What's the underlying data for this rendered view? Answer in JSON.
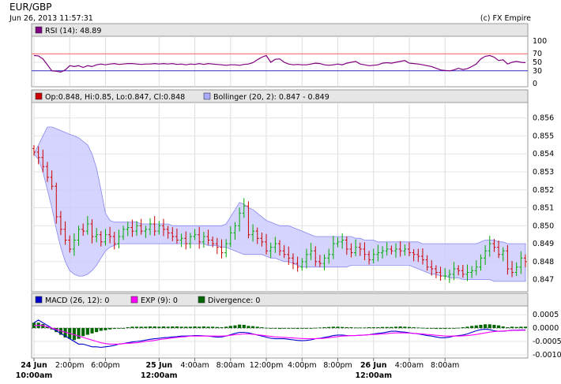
{
  "header": {
    "symbol": "EUR/GBP",
    "timestamp": "Jun 26, 2013 11:57:31",
    "credit": "(c) FX Empire"
  },
  "chart_data": [
    {
      "id": "rsi",
      "type": "line",
      "legend": "RSI (14): 48.89",
      "colors": {
        "line": "#800080",
        "upper": "#ff6666",
        "lower": "#3333cc",
        "swatch": "#800080"
      },
      "ylim": [
        0,
        100
      ],
      "ticks": [
        "100",
        "70",
        "50",
        "30",
        "0"
      ],
      "tick_values": [
        100,
        70,
        50,
        30,
        0
      ],
      "levels": [
        70,
        30
      ],
      "values": [
        66,
        65,
        58,
        44,
        30,
        29,
        27,
        32,
        42,
        40,
        42,
        38,
        42,
        40,
        44,
        46,
        44,
        46,
        47,
        45,
        46,
        47,
        47,
        46,
        45,
        46,
        46,
        47,
        46,
        47,
        46,
        47,
        45,
        46,
        44,
        46,
        45,
        47,
        45,
        47,
        46,
        45,
        44,
        43,
        44,
        44,
        43,
        45,
        46,
        49,
        56,
        62,
        66,
        50,
        57,
        58,
        50,
        46,
        44,
        45,
        44,
        44,
        46,
        48,
        47,
        44,
        43,
        44,
        46,
        44,
        48,
        50,
        52,
        46,
        44,
        42,
        43,
        44,
        48,
        49,
        48,
        50,
        52,
        54,
        48,
        47,
        46,
        44,
        42,
        40,
        36,
        32,
        31,
        30,
        32,
        36,
        33,
        35,
        40,
        46,
        58,
        64,
        66,
        62,
        54,
        56,
        46,
        50,
        52,
        50,
        49
      ]
    },
    {
      "id": "price",
      "type": "candlestick",
      "legend_ohlc": "Op:0.848, Hi:0.85, Lo:0.847, Cl:0.848",
      "legend_bollinger": "Bollinger (20, 2): 0.847 - 0.849",
      "colors": {
        "up": "#00aa00",
        "down": "#cc0000",
        "band_fill": "#ccccff",
        "band_edge": "#8888ee",
        "swatch_ohlc": "#cc0000",
        "swatch_boll": "#aaaaff"
      },
      "ylim": [
        0.8465,
        0.8566
      ],
      "ticks": [
        "0.856",
        "0.855",
        "0.854",
        "0.853",
        "0.852",
        "0.851",
        "0.850",
        "0.849",
        "0.848",
        "0.847"
      ],
      "tick_values": [
        0.856,
        0.855,
        0.854,
        0.853,
        0.852,
        0.851,
        0.85,
        0.849,
        0.848,
        0.847
      ],
      "close": [
        0.8541,
        0.8538,
        0.8533,
        0.8527,
        0.8522,
        0.8505,
        0.8498,
        0.8492,
        0.8487,
        0.8492,
        0.8498,
        0.8497,
        0.8501,
        0.8494,
        0.8495,
        0.8491,
        0.8495,
        0.8494,
        0.849,
        0.8494,
        0.8498,
        0.8499,
        0.8497,
        0.85,
        0.8497,
        0.8498,
        0.8501,
        0.8497,
        0.85,
        0.8498,
        0.8496,
        0.8494,
        0.8492,
        0.8493,
        0.849,
        0.8494,
        0.8495,
        0.8491,
        0.8494,
        0.8492,
        0.849,
        0.8488,
        0.8485,
        0.849,
        0.8496,
        0.85,
        0.8507,
        0.8511,
        0.8495,
        0.8497,
        0.8493,
        0.8491,
        0.8486,
        0.8488,
        0.849,
        0.8486,
        0.8484,
        0.8482,
        0.8479,
        0.8477,
        0.848,
        0.8484,
        0.8486,
        0.848,
        0.8479,
        0.8482,
        0.8484,
        0.849,
        0.8491,
        0.8492,
        0.8487,
        0.8485,
        0.8488,
        0.8487,
        0.8484,
        0.8481,
        0.8484,
        0.8485,
        0.8486,
        0.8487,
        0.8486,
        0.8487,
        0.8486,
        0.8487,
        0.8485,
        0.8484,
        0.8483,
        0.8481,
        0.8477,
        0.8476,
        0.8474,
        0.8472,
        0.8472,
        0.8473,
        0.8476,
        0.8475,
        0.8473,
        0.8474,
        0.8475,
        0.8477,
        0.8482,
        0.8486,
        0.849,
        0.8488,
        0.8484,
        0.8486,
        0.8476,
        0.8474,
        0.8477,
        0.8482,
        0.848
      ],
      "bollinger_upper": [
        0.854,
        0.8545,
        0.855,
        0.8555,
        0.8555,
        0.8554,
        0.8553,
        0.8552,
        0.8551,
        0.855,
        0.8549,
        0.8547,
        0.8545,
        0.854,
        0.8532,
        0.852,
        0.8507,
        0.8503,
        0.8502,
        0.8502,
        0.8502,
        0.8502,
        0.8502,
        0.8502,
        0.8501,
        0.8501,
        0.8501,
        0.8501,
        0.8501,
        0.8501,
        0.8501,
        0.85,
        0.85,
        0.85,
        0.85,
        0.85,
        0.85,
        0.85,
        0.85,
        0.85,
        0.85,
        0.85,
        0.85,
        0.8501,
        0.8505,
        0.8509,
        0.8513,
        0.8512,
        0.851,
        0.8509,
        0.8507,
        0.8505,
        0.8503,
        0.8502,
        0.8501,
        0.85,
        0.85,
        0.85,
        0.8499,
        0.8498,
        0.8497,
        0.8496,
        0.8495,
        0.8494,
        0.8494,
        0.8494,
        0.8494,
        0.8494,
        0.8494,
        0.8494,
        0.8494,
        0.8494,
        0.8493,
        0.8493,
        0.8492,
        0.8492,
        0.8492,
        0.8491,
        0.8491,
        0.8491,
        0.8491,
        0.8491,
        0.8491,
        0.8491,
        0.8491,
        0.8491,
        0.8491,
        0.849,
        0.849,
        0.849,
        0.849,
        0.849,
        0.849,
        0.849,
        0.849,
        0.849,
        0.849,
        0.849,
        0.849,
        0.849,
        0.8491,
        0.8492,
        0.8492,
        0.8492,
        0.8491,
        0.8491,
        0.849,
        0.849,
        0.849,
        0.849,
        0.849
      ],
      "bollinger_lower": [
        0.854,
        0.8537,
        0.853,
        0.852,
        0.851,
        0.8498,
        0.8488,
        0.848,
        0.8475,
        0.8473,
        0.8472,
        0.8472,
        0.8473,
        0.8475,
        0.8478,
        0.8482,
        0.8486,
        0.8488,
        0.8489,
        0.849,
        0.849,
        0.849,
        0.849,
        0.849,
        0.849,
        0.849,
        0.849,
        0.849,
        0.849,
        0.849,
        0.849,
        0.849,
        0.849,
        0.849,
        0.849,
        0.849,
        0.849,
        0.849,
        0.849,
        0.8489,
        0.8489,
        0.8489,
        0.8488,
        0.8488,
        0.8487,
        0.8486,
        0.8485,
        0.8484,
        0.8484,
        0.8484,
        0.8484,
        0.8484,
        0.8483,
        0.8482,
        0.8482,
        0.8481,
        0.848,
        0.848,
        0.8479,
        0.8478,
        0.8477,
        0.8477,
        0.8477,
        0.8477,
        0.8477,
        0.8477,
        0.8477,
        0.8477,
        0.8477,
        0.8477,
        0.8477,
        0.8478,
        0.8478,
        0.8478,
        0.8478,
        0.8478,
        0.8478,
        0.8478,
        0.8478,
        0.8478,
        0.8478,
        0.8478,
        0.8478,
        0.8478,
        0.8478,
        0.8477,
        0.8476,
        0.8475,
        0.8474,
        0.8473,
        0.8473,
        0.8472,
        0.8472,
        0.8471,
        0.8471,
        0.8471,
        0.847,
        0.847,
        0.847,
        0.847,
        0.847,
        0.847,
        0.847,
        0.8469,
        0.8469,
        0.8469,
        0.8469,
        0.8469,
        0.8469,
        0.8469,
        0.8469
      ]
    },
    {
      "id": "macd",
      "type": "bar+line",
      "legend_macd": "MACD (26, 12): 0",
      "legend_exp": "EXP (9): 0",
      "legend_div": "Divergence: 0",
      "colors": {
        "macd": "#0000cc",
        "exp": "#ff00ff",
        "div": "#006600"
      },
      "ylim": [
        -0.001,
        0.00065
      ],
      "ticks": [
        "0.0005",
        "0.0000",
        "-0.0005",
        "-0.0010"
      ],
      "tick_values": [
        0.0005,
        0,
        -0.0005,
        -0.001
      ],
      "divergence": [
        0.0002,
        0.0002,
        0.00015,
        5e-05,
        -5e-05,
        -0.00015,
        -0.00025,
        -0.00035,
        -0.0004,
        -0.00045,
        -0.0004,
        -0.0003,
        -0.00025,
        -0.0002,
        -0.00015,
        -0.0001,
        -8e-05,
        -5e-05,
        -3e-05,
        -2e-05,
        0,
        3e-05,
        5e-05,
        5e-05,
        5e-05,
        5e-05,
        6e-05,
        6e-05,
        5e-05,
        6e-05,
        5e-05,
        6e-05,
        6e-05,
        5e-05,
        5e-05,
        5e-05,
        6e-05,
        5e-05,
        6e-05,
        5e-05,
        5e-05,
        4e-05,
        3e-05,
        5e-05,
        8e-05,
        0.0001,
        0.00013,
        0.00012,
        8e-05,
        7e-05,
        5e-05,
        3e-05,
        1e-05,
        -1e-05,
        -2e-05,
        -3e-05,
        -2e-05,
        -1e-05,
        -2e-05,
        -3e-05,
        -2e-05,
        -1e-05,
        0,
        1e-05,
        2e-05,
        3e-05,
        4e-05,
        5e-05,
        5e-05,
        4e-05,
        3e-05,
        3e-05,
        2e-05,
        2e-05,
        2e-05,
        3e-05,
        3e-05,
        3e-05,
        4e-05,
        4e-05,
        4e-05,
        5e-05,
        6e-05,
        5e-05,
        4e-05,
        3e-05,
        2e-05,
        1e-05,
        -1e-05,
        -2e-05,
        -3e-05,
        -3e-05,
        -3e-05,
        -2e-05,
        -1e-05,
        1e-05,
        3e-05,
        5e-05,
        8e-05,
        0.0001,
        0.00012,
        0.00014,
        0.00014,
        0.00012,
        0.0001,
        6e-05,
        3e-05,
        5e-05,
        4e-05,
        5e-05,
        5e-05
      ],
      "macd": [
        0.0002,
        0.0003,
        0.0002,
        0.0001,
        0,
        -0.0001,
        -0.0002,
        -0.0003,
        -0.0004,
        -0.0005,
        -0.0006,
        -0.0006,
        -0.00065,
        -0.0007,
        -0.0007,
        -0.00072,
        -0.0007,
        -0.00068,
        -0.00065,
        -0.0006,
        -0.00058,
        -0.00055,
        -0.00052,
        -0.0005,
        -0.00048,
        -0.00045,
        -0.00042,
        -0.0004,
        -0.00038,
        -0.00036,
        -0.00035,
        -0.00033,
        -0.00032,
        -0.0003,
        -0.0003,
        -0.00029,
        -0.00028,
        -0.00028,
        -0.00029,
        -0.0003,
        -0.00032,
        -0.00034,
        -0.00033,
        -0.0003,
        -0.00025,
        -0.0002,
        -0.00016,
        -0.00016,
        -0.00018,
        -0.00022,
        -0.00026,
        -0.0003,
        -0.00034,
        -0.00038,
        -0.0004,
        -0.0004,
        -0.0004,
        -0.00042,
        -0.00044,
        -0.00046,
        -0.00047,
        -0.00046,
        -0.00044,
        -0.0004,
        -0.00038,
        -0.00035,
        -0.00032,
        -0.00028,
        -0.00026,
        -0.00026,
        -0.00028,
        -0.00028,
        -0.00028,
        -0.00027,
        -0.00026,
        -0.00025,
        -0.00022,
        -0.0002,
        -0.00018,
        -0.00015,
        -0.00012,
        -0.00012,
        -0.00014,
        -0.00015,
        -0.00018,
        -0.0002,
        -0.00022,
        -0.00025,
        -0.00028,
        -0.0003,
        -0.00033,
        -0.00036,
        -0.00036,
        -0.00034,
        -0.0003,
        -0.00028,
        -0.00026,
        -0.00022,
        -0.00016,
        -0.0001,
        -6e-05,
        -4e-05,
        -6e-05,
        -0.0001,
        -0.00012,
        -0.00012,
        -0.0001,
        -8e-05,
        -8e-05,
        -7e-05,
        -7e-05
      ],
      "exp": [
        0.0001,
        0.0001,
        0.0001,
        5e-05,
        0,
        -5e-05,
        -0.0001,
        -0.00015,
        -0.0002,
        -0.00025,
        -0.0003,
        -0.00035,
        -0.0004,
        -0.00045,
        -0.0005,
        -0.00055,
        -0.00058,
        -0.0006,
        -0.0006,
        -0.0006,
        -0.00058,
        -0.00057,
        -0.00056,
        -0.00055,
        -0.00053,
        -0.0005,
        -0.00048,
        -0.00046,
        -0.00043,
        -0.00041,
        -0.00039,
        -0.00037,
        -0.00035,
        -0.00033,
        -0.00032,
        -0.0003,
        -0.0003,
        -0.0003,
        -0.0003,
        -0.0003,
        -0.0003,
        -0.0003,
        -0.0003,
        -0.00029,
        -0.00027,
        -0.00025,
        -0.00023,
        -0.00022,
        -0.00022,
        -0.00023,
        -0.00025,
        -0.00027,
        -0.00029,
        -0.00031,
        -0.00033,
        -0.00034,
        -0.00035,
        -0.00036,
        -0.00037,
        -0.00038,
        -0.00039,
        -0.0004,
        -0.0004,
        -0.0004,
        -0.00039,
        -0.00038,
        -0.00036,
        -0.00034,
        -0.00032,
        -0.0003,
        -0.00029,
        -0.00028,
        -0.00028,
        -0.00027,
        -0.00026,
        -0.00025,
        -0.00024,
        -0.00023,
        -0.00022,
        -0.00021,
        -0.00019,
        -0.00018,
        -0.00018,
        -0.00018,
        -0.00019,
        -0.0002,
        -0.00021,
        -0.00022,
        -0.00024,
        -0.00025,
        -0.00027,
        -0.00028,
        -0.0003,
        -0.0003,
        -0.0003,
        -0.0003,
        -0.00029,
        -0.00028,
        -0.00026,
        -0.00024,
        -0.00021,
        -0.00018,
        -0.00015,
        -0.00013,
        -0.00012,
        -0.00011,
        -0.0001,
        -9e-05,
        -9e-05,
        -8e-05,
        -8e-05
      ]
    }
  ],
  "x_axis": {
    "labels": [
      {
        "text": "24 Jun",
        "sub": "10:00am",
        "major": true,
        "i": 0
      },
      {
        "text": "2:00pm",
        "i": 8
      },
      {
        "text": "6:00pm",
        "i": 16
      },
      {
        "text": "25 Jun",
        "sub": "12:00am",
        "major": true,
        "i": 28
      },
      {
        "text": "4:00am",
        "i": 36
      },
      {
        "text": "8:00am",
        "i": 44
      },
      {
        "text": "12:00pm",
        "i": 52
      },
      {
        "text": "4:00pm",
        "i": 60
      },
      {
        "text": "8:00pm",
        "i": 68
      },
      {
        "text": "26 Jun",
        "sub": "12:00am",
        "major": true,
        "i": 76
      },
      {
        "text": "4:00am",
        "i": 84
      },
      {
        "text": "8:00am",
        "i": 92
      }
    ]
  }
}
